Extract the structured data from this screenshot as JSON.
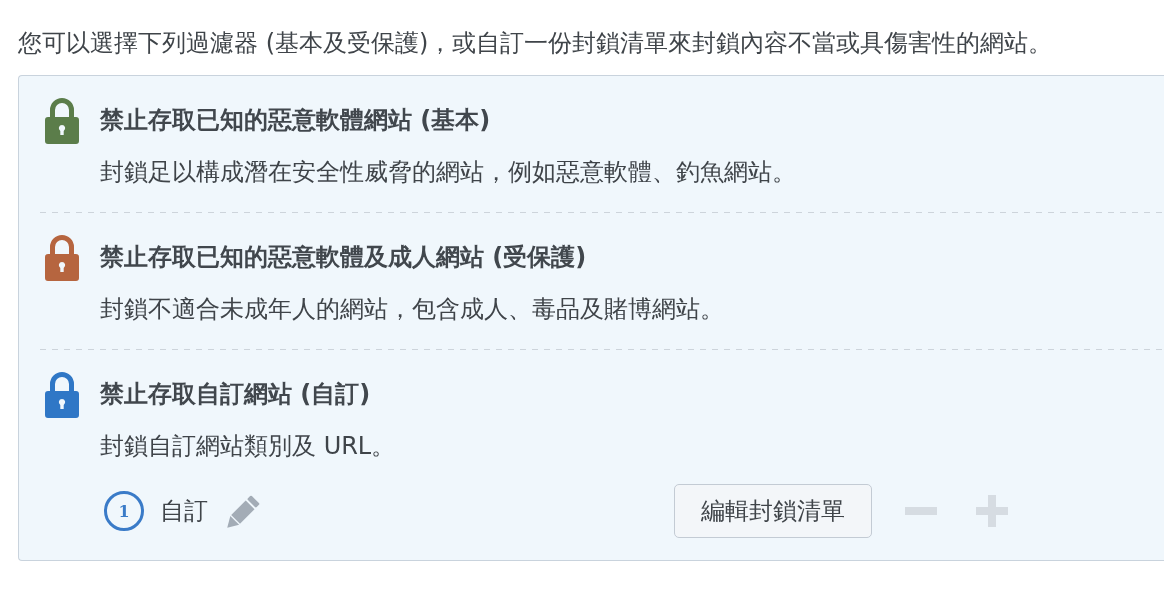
{
  "intro": "您可以選擇下列過濾器 (基本及受保護)，或自訂一份封鎖清單來封鎖內容不當或具傷害性的網站。",
  "filters": [
    {
      "title": "禁止存取已知的惡意軟體網站 (基本)",
      "description": "封鎖足以構成潛在安全性威脅的網站，例如惡意軟體、釣魚網站。",
      "color": "#5b7d4a"
    },
    {
      "title": "禁止存取已知的惡意軟體及成人網站 (受保護)",
      "description": "封鎖不適合未成年人的網站，包含成人、毒品及賭博網站。",
      "color": "#b6653f"
    },
    {
      "title": "禁止存取自訂網站 (自訂)",
      "description": "封鎖自訂網站類別及 URL。",
      "color": "#2f77c6",
      "block_list": {
        "count": "1",
        "name": "自訂",
        "edit_button": "編輯封鎖清單",
        "actions": [
          {
            "kind": "remove",
            "disabled": true
          },
          {
            "kind": "add",
            "disabled": true
          }
        ]
      }
    }
  ]
}
